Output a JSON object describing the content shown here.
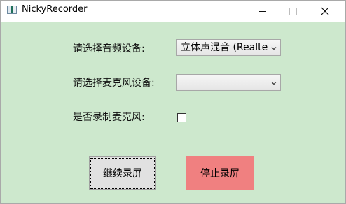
{
  "window": {
    "title": "NickyRecorder",
    "minimize_symbol": "—",
    "maximize_symbol": "☐",
    "close_symbol": "✕"
  },
  "form": {
    "audio_device_label": "请选择音频设备:",
    "audio_device_value": "立体声混音 (Realtek",
    "microphone_device_label": "请选择麦克风设备:",
    "microphone_device_value": "",
    "record_microphone_label": "是否录制麦克风:",
    "record_microphone_checked": false
  },
  "buttons": {
    "continue_label": "继续录屏",
    "stop_label": "停止录屏"
  },
  "colors": {
    "background": "#cde8cd",
    "stop_button": "#f08080",
    "continue_button": "#e1e1e1"
  },
  "icons": {
    "app": "window-icon",
    "dropdown": "chevron-down-icon"
  }
}
